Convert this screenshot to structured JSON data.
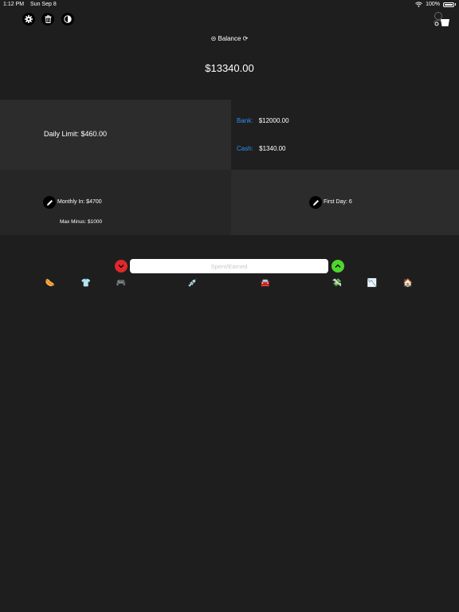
{
  "status_bar": {
    "time": "1:12 PM",
    "date": "Sun Sep 8",
    "battery": "100%",
    "battery_level": 1.0,
    "wifi_icon": "wifi-icon"
  },
  "toolbar": {
    "icons": [
      "gear-icon",
      "trash-icon",
      "contrast-icon"
    ],
    "profile_icon": "cart-person-icon"
  },
  "balance": {
    "label": "⊝ Balance ⟳",
    "value": "$13340.00"
  },
  "daily_limit": {
    "text": "Daily Limit: $460.00"
  },
  "accounts": {
    "bank_label": "Bank:",
    "bank_value": "$12000.00",
    "cash_label": "Cash:",
    "cash_value": "$1340.00",
    "label_color": "#2f8ef5"
  },
  "monthly": {
    "text": "Monthly In: $4700",
    "max_minus": "Max Minus: $1000"
  },
  "first_day": {
    "text": "First Day: 6"
  },
  "entry": {
    "placeholder": "Spent/Earned",
    "minus_color": "#e0282b",
    "plus_color": "#4fd62e"
  },
  "categories": [
    {
      "name": "food",
      "glyph": "🌭"
    },
    {
      "name": "clothes",
      "glyph": "👕"
    },
    {
      "name": "games",
      "glyph": "🎮"
    },
    {
      "name": "health",
      "glyph": "💉"
    },
    {
      "name": "transport",
      "glyph": "🚘"
    },
    {
      "name": "money",
      "glyph": "💸"
    },
    {
      "name": "stats",
      "glyph": "📉"
    },
    {
      "name": "home",
      "glyph": "🏠"
    }
  ]
}
